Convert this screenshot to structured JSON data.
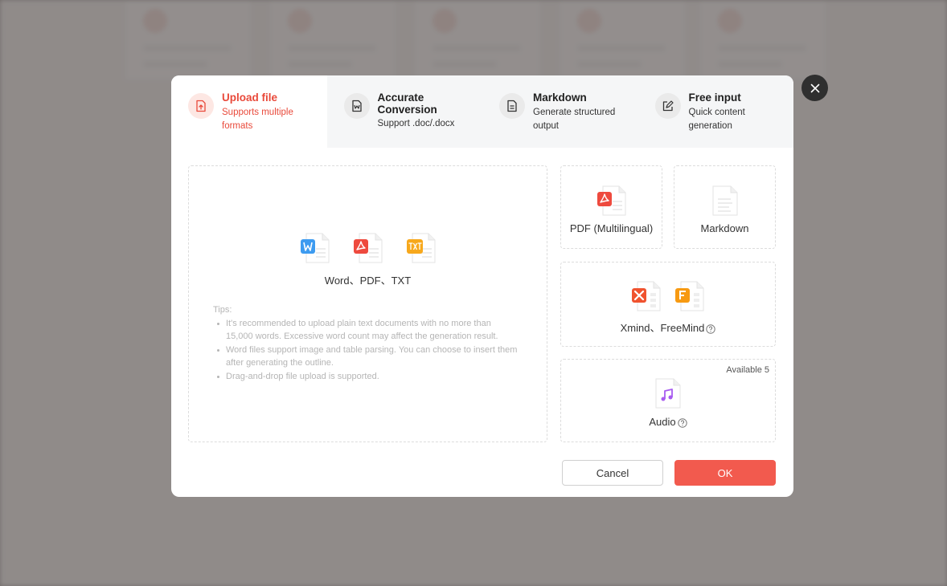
{
  "tabs": [
    {
      "title": "Upload file",
      "subtitle": "Supports multiple formats",
      "active": true,
      "icon": "upload-file-icon"
    },
    {
      "title": "Accurate Conversion",
      "subtitle": "Support .doc/.docx",
      "active": false,
      "icon": "word-doc-icon"
    },
    {
      "title": "Markdown",
      "subtitle": "Generate structured output",
      "active": false,
      "icon": "document-lines-icon"
    },
    {
      "title": "Free input",
      "subtitle": "Quick content generation",
      "active": false,
      "icon": "edit-icon"
    }
  ],
  "upload": {
    "formats_label": "Word、PDF、TXT",
    "tips_title": "Tips:",
    "tips": [
      "It's recommended to upload plain text documents with no more than 15,000 words. Excessive word count may affect the generation result.",
      "Word files support image and table parsing. You can choose to insert them after generating the outline.",
      "Drag-and-drop file upload is supported."
    ]
  },
  "options": {
    "pdf_label": "PDF (Multilingual)",
    "markdown_label": "Markdown",
    "mindmap_label": "Xmind、FreeMind",
    "audio_label": "Audio",
    "audio_available": "Available 5"
  },
  "buttons": {
    "cancel": "Cancel",
    "ok": "OK"
  },
  "colors": {
    "accent": "#f25a4e",
    "accent_text": "#e9493a",
    "tab_bar": "#f5f6f7"
  }
}
